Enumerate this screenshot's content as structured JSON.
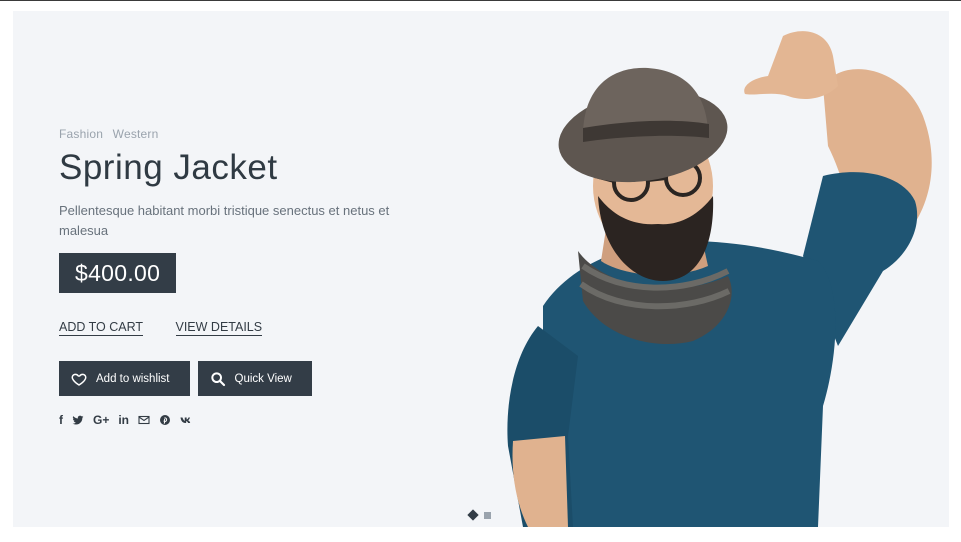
{
  "slide": {
    "tags": [
      "Fashion",
      "Western"
    ],
    "title": "Spring Jacket",
    "description": "Pellentesque habitant morbi tristique senectus et netus et malesua",
    "price": "$400.00",
    "links": {
      "add_to_cart": "ADD TO CART",
      "view_details": "VIEW DETAILS"
    },
    "buttons": {
      "wishlist": "Add to wishlist",
      "quick_view": "Quick View"
    },
    "social": [
      {
        "name": "facebook-icon",
        "glyph": "f"
      },
      {
        "name": "twitter-icon",
        "glyph": "twitter"
      },
      {
        "name": "google-plus-icon",
        "glyph": "G+"
      },
      {
        "name": "linkedin-icon",
        "glyph": "in"
      },
      {
        "name": "email-icon",
        "glyph": "envelope"
      },
      {
        "name": "pinterest-icon",
        "glyph": "pinterest"
      },
      {
        "name": "vk-icon",
        "glyph": "vk"
      }
    ]
  },
  "pagination": {
    "total": 2,
    "active": 1
  },
  "colors": {
    "background": "#f3f5f8",
    "dark": "#333d47",
    "sweater": "#1f5573",
    "muted": "#9aa3ad"
  }
}
